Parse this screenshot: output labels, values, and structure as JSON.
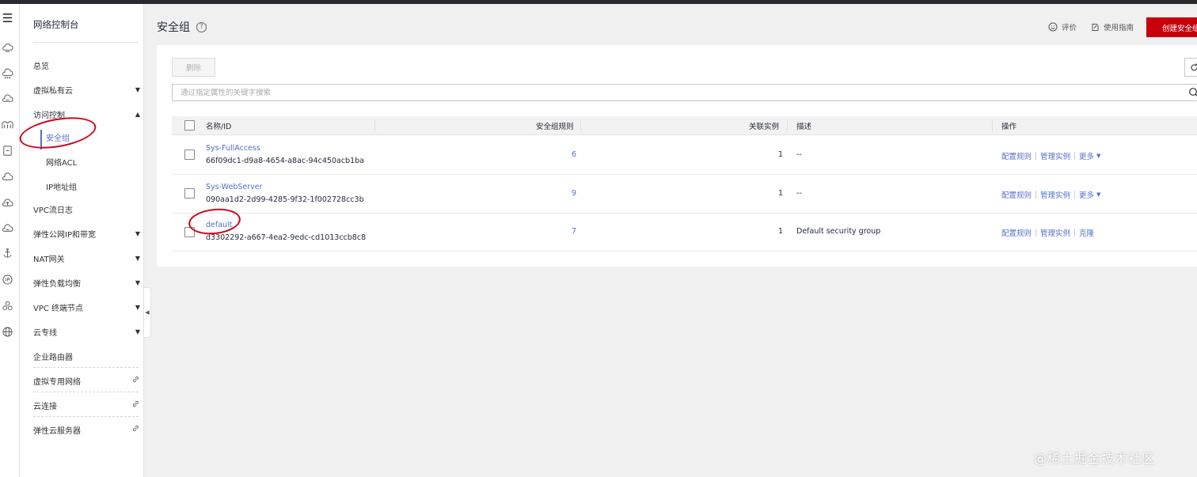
{
  "nav": {
    "title": "网络控制台",
    "items": {
      "overview": "总览",
      "vpc": "虚拟私有云",
      "access_control": "访问控制",
      "security_group": "安全组",
      "network_acl": "网络ACL",
      "ip_group": "IP地址组",
      "vpc_flow_log": "VPC流日志",
      "eip": "弹性公网IP和带宽",
      "nat": "NAT网关",
      "elb": "弹性负载均衡",
      "vpcep": "VPC 终端节点",
      "direct_connect": "云专线",
      "enterprise_router": "企业路由器",
      "vpn": "虚拟专用网络",
      "cloud_connect": "云连接",
      "ecs": "弹性云服务器"
    }
  },
  "header": {
    "title": "安全组",
    "help": "?",
    "feedback": "评价",
    "guide": "使用指南",
    "create": "创建安全组"
  },
  "toolbar": {
    "delete": "删除",
    "search_placeholder": "通过指定属性的关键字搜索"
  },
  "table": {
    "headers": {
      "name_id": "名称/ID",
      "rules": "安全组规则",
      "instances": "关联实例",
      "description": "描述",
      "operations": "操作"
    },
    "rows": [
      {
        "name": "Sys-FullAccess",
        "id": "66f09dc1-d9a8-4654-a8ac-94c450acb1ba",
        "rules": "6",
        "instances": "1",
        "description": "--",
        "op1": "配置规则",
        "op2": "管理实例",
        "op3": "更多"
      },
      {
        "name": "Sys-WebServer",
        "id": "090aa1d2-2d99-4285-9f32-1f002728cc3b",
        "rules": "9",
        "instances": "1",
        "description": "--",
        "op1": "配置规则",
        "op2": "管理实例",
        "op3": "更多"
      },
      {
        "name": "default",
        "id": "d3302292-a667-4ea2-9edc-cd1013ccb8c8",
        "rules": "7",
        "instances": "1",
        "description": "Default security group",
        "op1": "配置规则",
        "op2": "管理实例",
        "op3": "克隆"
      }
    ]
  },
  "watermark": "@稀土掘金技术社区",
  "colors": {
    "accent": "#526ecc",
    "brand": "#c7000b",
    "annotation": "#d0021b"
  }
}
